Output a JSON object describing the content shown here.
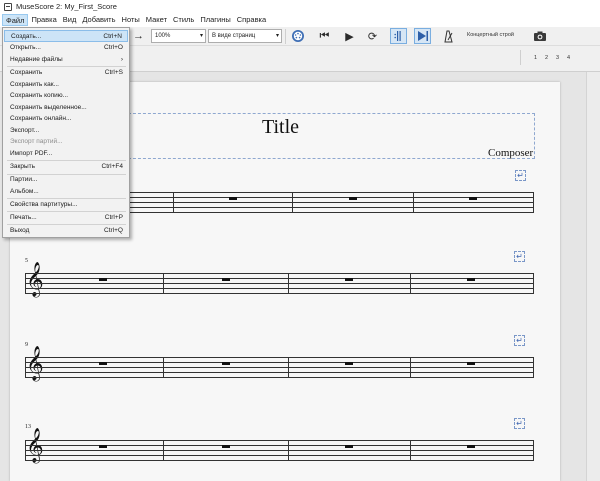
{
  "window": {
    "title": "MuseScore 2: My_First_Score"
  },
  "menubar": [
    "Файл",
    "Правка",
    "Вид",
    "Добавить",
    "Ноты",
    "Макет",
    "Стиль",
    "Плагины",
    "Справка"
  ],
  "toolbar": {
    "zoom": "100%",
    "view_mode": "В виде страниц",
    "concert_pitch": "Концертный строй"
  },
  "palette": {
    "notes": [
      "♪",
      "♩",
      "𝅗𝅥",
      "𝅝",
      "𝅜",
      "·",
      "𝄾",
      "♪",
      "𝄽",
      "𝄪",
      "♯",
      "♮",
      "♭",
      "𝄫",
      "♫"
    ],
    "voices": [
      "1",
      "2",
      "3",
      "4"
    ]
  },
  "score": {
    "title": "Title",
    "composer": "Composer",
    "measure_numbers": [
      "5",
      "9",
      "13"
    ]
  },
  "file_menu": {
    "items": [
      {
        "label": "Создать...",
        "shortcut": "Ctrl+N",
        "state": "highlighted"
      },
      {
        "label": "Открыть...",
        "shortcut": "Ctrl+O"
      },
      {
        "label": "Недавние файлы",
        "shortcut": "›"
      },
      {
        "label": "Сохранить",
        "shortcut": "Ctrl+S"
      },
      {
        "label": "Сохранить как..."
      },
      {
        "label": "Сохранить копию..."
      },
      {
        "label": "Сохранить выделенное..."
      },
      {
        "label": "Сохранить онлайн..."
      },
      {
        "label": "Экспорт..."
      },
      {
        "label": "Экспорт партий...",
        "state": "disabled"
      },
      {
        "label": "Импорт PDF..."
      },
      {
        "label": "Закрыть",
        "shortcut": "Ctrl+F4"
      },
      {
        "label": "Партии..."
      },
      {
        "label": "Альбом..."
      },
      {
        "label": "Свойства партитуры..."
      },
      {
        "label": "Печать...",
        "shortcut": "Ctrl+P"
      },
      {
        "label": "Выход",
        "shortcut": "Ctrl+Q"
      }
    ]
  }
}
